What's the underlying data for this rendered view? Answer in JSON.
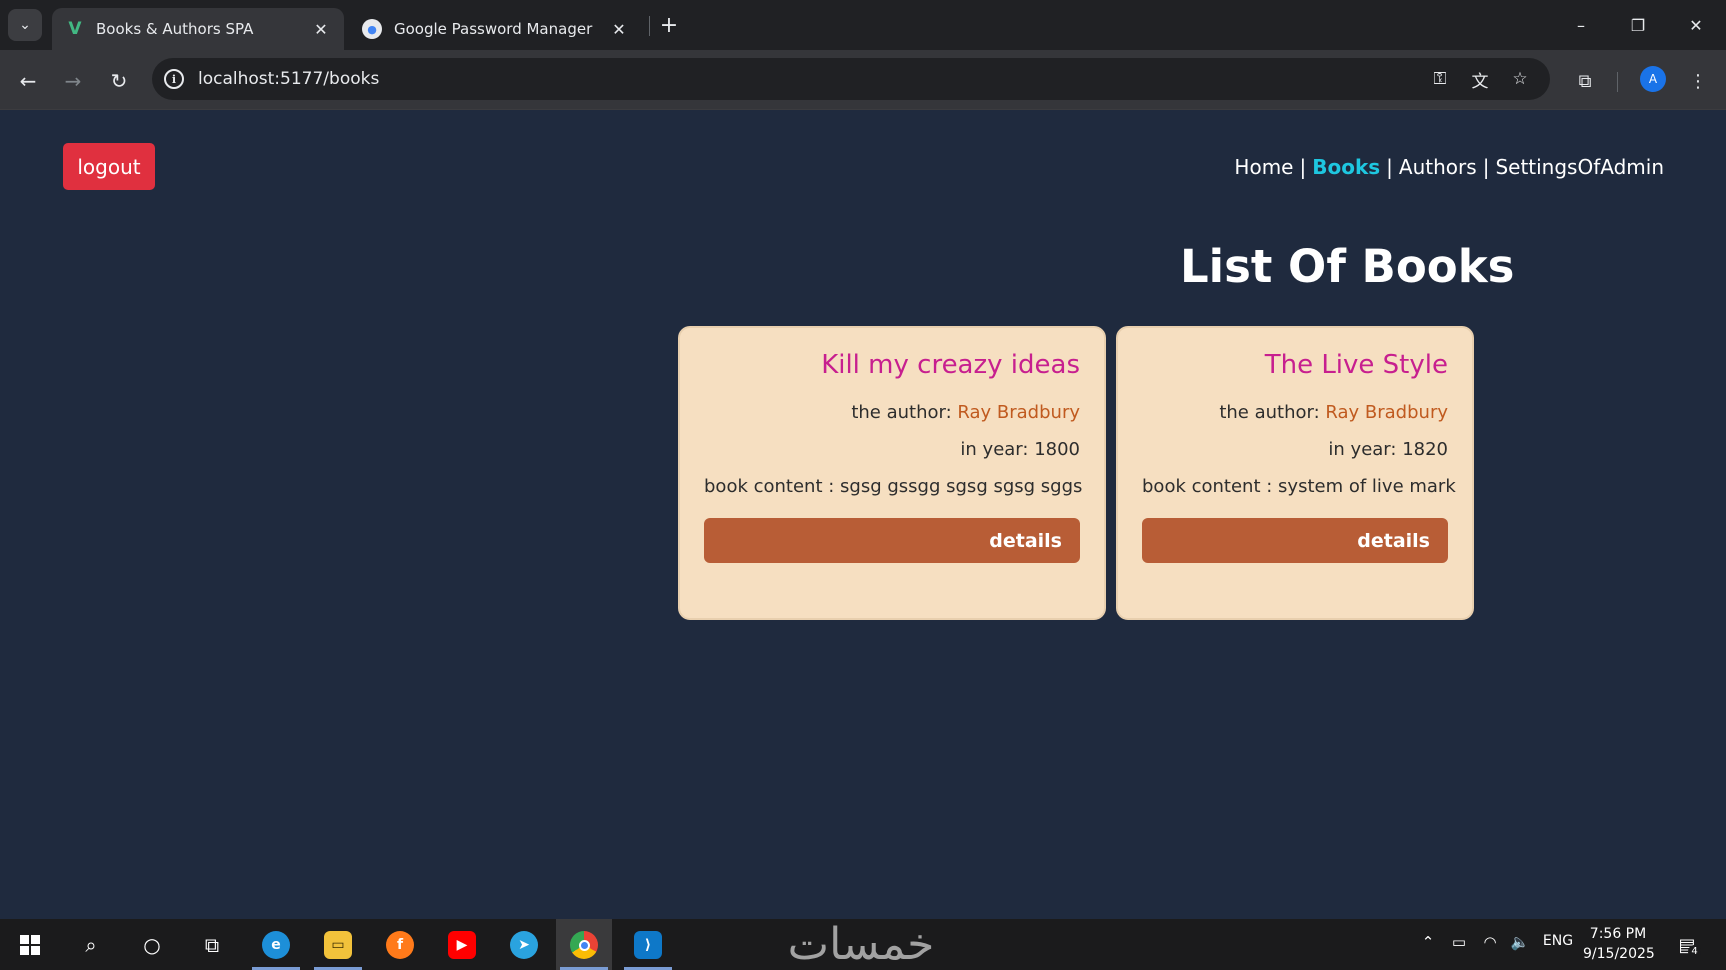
{
  "browser": {
    "tab_search_icon": "chevron-down-icon",
    "tabs": [
      {
        "title": "Books & Authors SPA",
        "favicon": "vue-logo-icon",
        "active": true
      },
      {
        "title": "Google Password Manager",
        "favicon": "google-password-manager-icon",
        "active": false
      }
    ],
    "tab_close_glyph": "✕",
    "new_tab_glyph": "+",
    "url": "localhost:5177/books",
    "profile_initial": "A"
  },
  "page": {
    "logout_label": "logout",
    "nav": {
      "home": "Home",
      "books": "Books",
      "authors": "Authors",
      "settings": "SettingsOfAdmin",
      "separator": "|",
      "active": "books"
    },
    "title": "List Of Books",
    "books": [
      {
        "title": "Kill my creazy ideas",
        "author_label": "the author:",
        "author": "Ray Bradbury",
        "year_label": "in year:",
        "year": "1800",
        "content_label": "book content :",
        "content": "sgsg gssgg sgsg sgsg sggs",
        "details_label": "details"
      },
      {
        "title": "The Live Style",
        "author_label": "the author:",
        "author": "Ray Bradbury",
        "year_label": "in year:",
        "year": "1820",
        "content_label": "book content :",
        "content": "system of live mark",
        "details_label": "details"
      }
    ]
  },
  "colors": {
    "page_bg": "#1f2a3e",
    "logout_bg": "#e0303f",
    "nav_active": "#1ec7e0",
    "card_bg": "#f6dfc1",
    "card_title": "#c71f8f",
    "author_name": "#c05a1f",
    "details_bg": "#b85d36"
  },
  "taskbar": {
    "watermark": "خمسات",
    "language": "ENG",
    "time": "7:56 PM",
    "date": "9/15/2025",
    "notification_count": "4"
  }
}
